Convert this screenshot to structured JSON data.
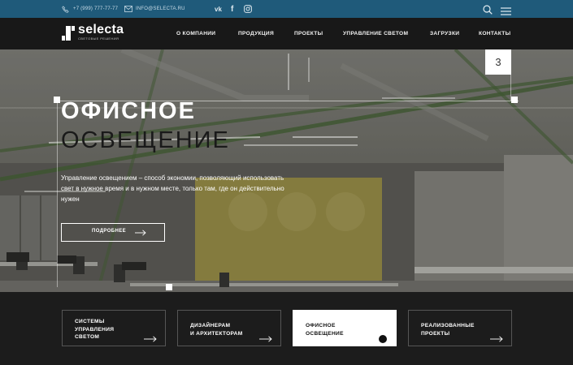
{
  "topbar": {
    "phone": "+7 (999) 777-77-77",
    "email": "INFO@SELECTA.RU",
    "social": {
      "vk": "vk",
      "fb": "f"
    },
    "icons": [
      "phone-icon",
      "mail-icon",
      "vk-icon",
      "facebook-icon",
      "instagram-icon",
      "search-icon",
      "menu-icon"
    ],
    "bg_color": "#1f5a7a"
  },
  "logo": {
    "name": "selecta",
    "sub": "СВЕТОВЫЕ РЕШЕНИЯ"
  },
  "nav": {
    "items": [
      "О КОМПАНИИ",
      "ПРОДУКЦИЯ",
      "ПРОЕКТЫ",
      "УПРАВЛЕНИЕ СВЕТОМ",
      "ЗАГРУЗКИ",
      "КОНТАКТЫ"
    ]
  },
  "hero": {
    "slide_number": "3",
    "title_line1": "ОФИСНОЕ",
    "title_line2": "ОСВЕЩЕНИЕ",
    "description": "Управление освещением – способ экономии, позволяющий использовать свет в нужное время и в нужном месте, только там, где он действительно нужен",
    "button_label": "ПОДРОБНЕЕ"
  },
  "cards": [
    {
      "label": "СИСТЕМЫ\nУПРАВЛЕНИЯ\nСВЕТОМ",
      "active": false
    },
    {
      "label": "ДИЗАЙНЕРАМ\nИ АРХИТЕКТОРАМ",
      "active": false
    },
    {
      "label": "ОФИСНОЕ\nОСВЕЩЕНИЕ",
      "active": true
    },
    {
      "label": "РЕАЛИЗОВАННЫЕ\nПРОЕКТЫ",
      "active": false
    }
  ],
  "colors": {
    "accent": "#1f5a7a",
    "dark": "#181818",
    "card_active": "#ffffff"
  }
}
